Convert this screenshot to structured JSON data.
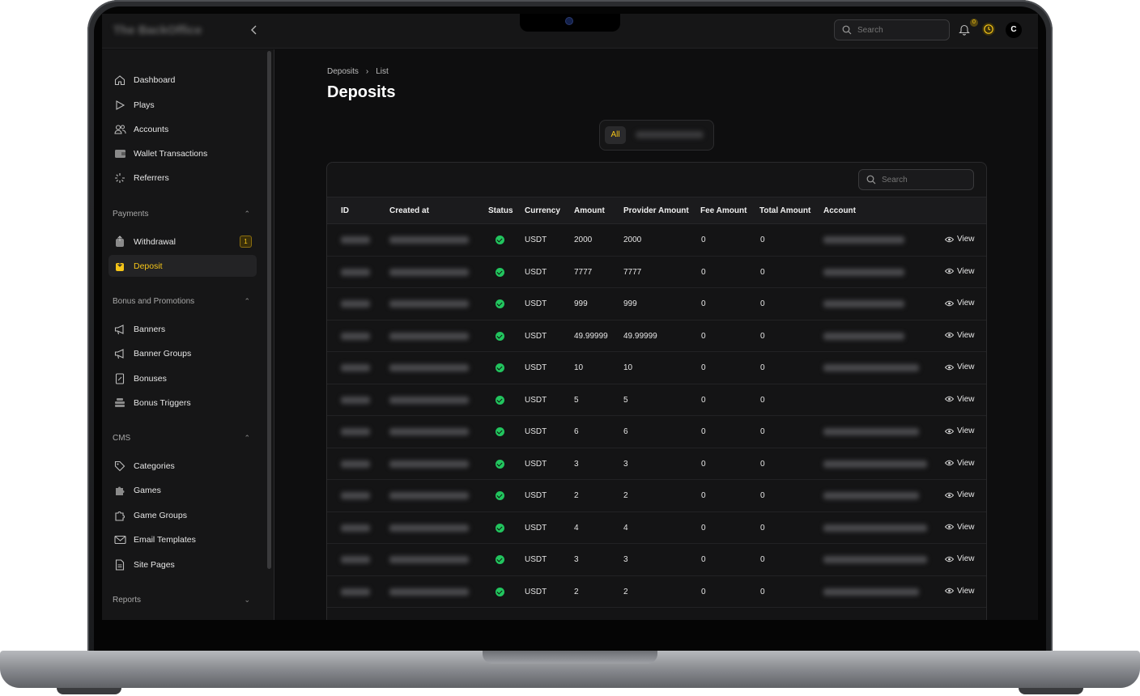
{
  "topbar": {
    "logo_text": "The BackOffice",
    "search_placeholder": "Search",
    "notification_count": "0",
    "avatar_initial": "C"
  },
  "sidebar": {
    "main_items": [
      {
        "label": "Dashboard",
        "icon": "home-icon"
      },
      {
        "label": "Plays",
        "icon": "play-icon"
      },
      {
        "label": "Accounts",
        "icon": "users-icon"
      },
      {
        "label": "Wallet Transactions",
        "icon": "wallet-icon"
      },
      {
        "label": "Referrers",
        "icon": "sparkle-icon"
      }
    ],
    "payments": {
      "title": "Payments",
      "items": [
        {
          "label": "Withdrawal",
          "badge": "1"
        },
        {
          "label": "Deposit"
        }
      ]
    },
    "bonus": {
      "title": "Bonus and Promotions",
      "items": [
        {
          "label": "Banners"
        },
        {
          "label": "Banner Groups"
        },
        {
          "label": "Bonuses"
        },
        {
          "label": "Bonus Triggers"
        }
      ]
    },
    "cms": {
      "title": "CMS",
      "items": [
        {
          "label": "Categories"
        },
        {
          "label": "Games"
        },
        {
          "label": "Game Groups"
        },
        {
          "label": "Email Templates"
        },
        {
          "label": "Site Pages"
        }
      ]
    },
    "reports": {
      "title": "Reports"
    }
  },
  "breadcrumb": {
    "first": "Deposits",
    "second": "List"
  },
  "page_title": "Deposits",
  "tabs": {
    "all": "All"
  },
  "table": {
    "search_placeholder": "Search",
    "columns": [
      "ID",
      "Created at",
      "Status",
      "Currency",
      "Amount",
      "Provider Amount",
      "Fee Amount",
      "Total Amount",
      "Account"
    ],
    "view_label": "View",
    "rows": [
      {
        "currency": "USDT",
        "amount": "2000",
        "provider_amount": "2000",
        "fee": "0",
        "total": "0"
      },
      {
        "currency": "USDT",
        "amount": "7777",
        "provider_amount": "7777",
        "fee": "0",
        "total": "0"
      },
      {
        "currency": "USDT",
        "amount": "999",
        "provider_amount": "999",
        "fee": "0",
        "total": "0"
      },
      {
        "currency": "USDT",
        "amount": "49.99999",
        "provider_amount": "49.99999",
        "fee": "0",
        "total": "0"
      },
      {
        "currency": "USDT",
        "amount": "10",
        "provider_amount": "10",
        "fee": "0",
        "total": "0"
      },
      {
        "currency": "USDT",
        "amount": "5",
        "provider_amount": "5",
        "fee": "0",
        "total": "0"
      },
      {
        "currency": "USDT",
        "amount": "6",
        "provider_amount": "6",
        "fee": "0",
        "total": "0"
      },
      {
        "currency": "USDT",
        "amount": "3",
        "provider_amount": "3",
        "fee": "0",
        "total": "0"
      },
      {
        "currency": "USDT",
        "amount": "2",
        "provider_amount": "2",
        "fee": "0",
        "total": "0"
      },
      {
        "currency": "USDT",
        "amount": "4",
        "provider_amount": "4",
        "fee": "0",
        "total": "0"
      },
      {
        "currency": "USDT",
        "amount": "3",
        "provider_amount": "3",
        "fee": "0",
        "total": "0"
      },
      {
        "currency": "USDT",
        "amount": "2",
        "provider_amount": "2",
        "fee": "0",
        "total": "0"
      }
    ]
  },
  "colors": {
    "accent": "#f5c518",
    "success": "#22c55e",
    "background": "#0e0e0f",
    "surface": "#161617"
  }
}
